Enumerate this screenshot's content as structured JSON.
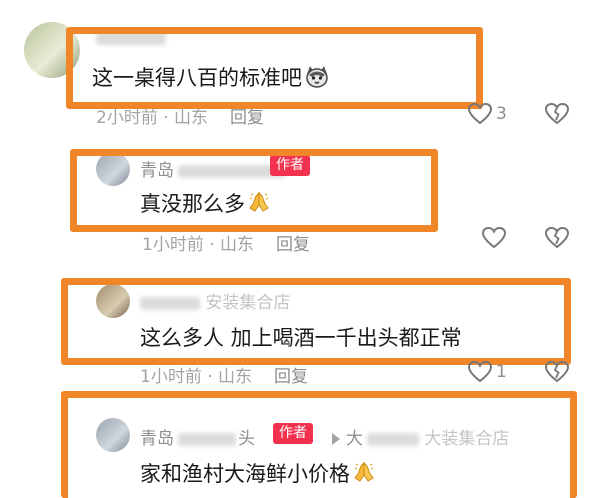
{
  "comments": [
    {
      "content": "这一桌得八百的标准吧",
      "time": "2小时前",
      "location": "山东",
      "reply_label": "回复",
      "like_count": "3"
    },
    {
      "name_prefix": "青岛",
      "author_badge": "作者",
      "content": "真没那么多",
      "time": "1小时前",
      "location": "山东",
      "reply_label": "回复"
    },
    {
      "name_suffix": "安装集合店",
      "content": "这么多人 加上喝酒一千出头都正常",
      "time": "1小时前",
      "location": "山东",
      "reply_label": "回复",
      "like_count": "1"
    },
    {
      "name_prefix": "青岛",
      "name_part": "头",
      "author_badge": "作者",
      "reply_to_prefix": "大",
      "reply_to_suffix": "大装集合店",
      "content": "家和渔村大海鲜小价格"
    }
  ],
  "colors": {
    "highlight": "#f18628",
    "badge": "#f2314f"
  },
  "icons": [
    "heart-outline-icon",
    "broken-heart-icon",
    "pray-hands-emoji",
    "husky-emoji",
    "arrow-right-icon"
  ]
}
